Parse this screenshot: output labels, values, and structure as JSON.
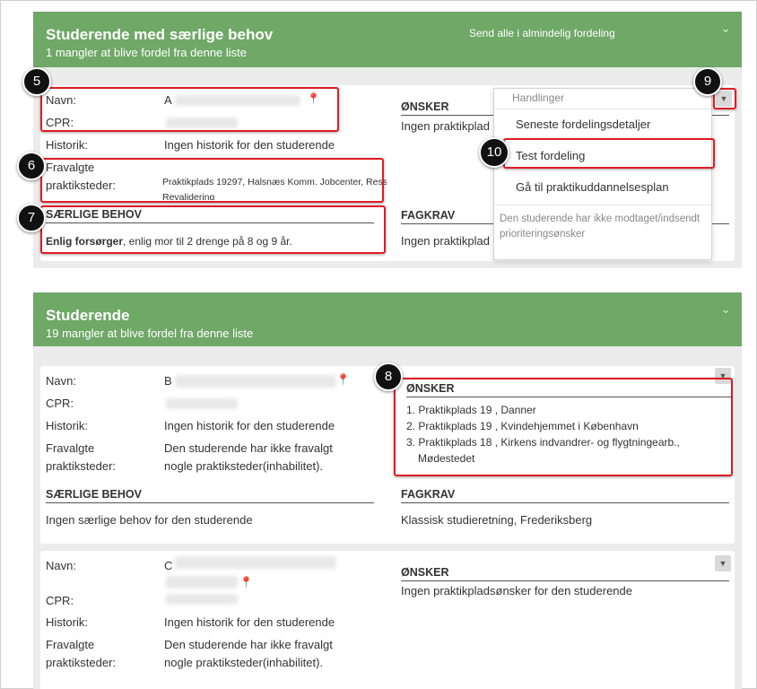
{
  "colors": {
    "header_green": "#6fa867",
    "highlight_red": "#e01b24",
    "badge_black": "#111111"
  },
  "section1": {
    "title": "Studerende med særlige behov",
    "subtitle": "1 mangler at blive fordel fra denne liste",
    "action": "Send alle i almindelig fordeling",
    "chevron_icon": "chevron-down-icon",
    "card": {
      "name_label": "Navn:",
      "name_value": "A",
      "cpr_label": "CPR:",
      "history_label": "Historik:",
      "history_value": "Ingen historik for den studerende",
      "opted_out_label_1": "Fravalgte",
      "opted_out_label_2": "praktiksteder:",
      "opted_out_value_1": "Praktikplads 19297, Halsnæs Komm. Jobcenter, Ressource og",
      "opted_out_value_2": "Revalidering",
      "special_heading": "SÆRLIGE BEHOV",
      "special_bold": "Enlig forsørger",
      "special_rest": ", enlig mor til 2 drenge på 8 og 9 år.",
      "wishes_heading": "ØNSKER",
      "wishes_value": "Ingen praktikplad",
      "req_heading": "FAGKRAV",
      "req_value": "Ingen praktikplad"
    },
    "menu": {
      "header": "Handlinger",
      "items": [
        "Seneste fordelingsdetaljer",
        "Test fordeling",
        "Gå til praktikuddannelsesplan"
      ],
      "note": "Den studerende har ikke modtaget/indsendt prioriteringsønsker"
    }
  },
  "section2": {
    "title": "Studerende",
    "subtitle": "19 mangler at blive fordel fra denne liste",
    "chevron_icon": "chevron-down-icon",
    "card1": {
      "name_label": "Navn:",
      "name_value": "B",
      "cpr_label": "CPR:",
      "history_label": "Historik:",
      "history_value": "Ingen historik for den studerende",
      "opted_out_label_1": "Fravalgte",
      "opted_out_label_2": "praktiksteder:",
      "opted_out_value_1": "Den studerende har ikke fravalgt",
      "opted_out_value_2": "nogle praktiksteder(inhabilitet).",
      "special_heading": "SÆRLIGE BEHOV",
      "special_value": "Ingen særlige behov for den studerende",
      "wishes_heading": "ØNSKER",
      "wishes": [
        "1. Praktikplads 19   , Danner",
        "2. Praktikplads 19   , Kvindehjemmet i København",
        "3. Praktikplads 18   , Kirkens indvandrer- og flygtningearb., Mødestedet"
      ],
      "req_heading": "FAGKRAV",
      "req_value": "Klassisk studieretning, Frederiksberg"
    },
    "card2": {
      "name_label": "Navn:",
      "name_value": "C",
      "cpr_label": "CPR:",
      "history_label": "Historik:",
      "history_value": "Ingen historik for den studerende",
      "opted_out_label_1": "Fravalgte",
      "opted_out_label_2": "praktiksteder:",
      "opted_out_value_1": "Den studerende har ikke fravalgt",
      "opted_out_value_2": "nogle praktiksteder(inhabilitet).",
      "wishes_heading": "ØNSKER",
      "wishes_value": "Ingen praktikpladsønsker for den studerende"
    }
  },
  "annotations": [
    "5",
    "6",
    "7",
    "8",
    "9",
    "10"
  ]
}
